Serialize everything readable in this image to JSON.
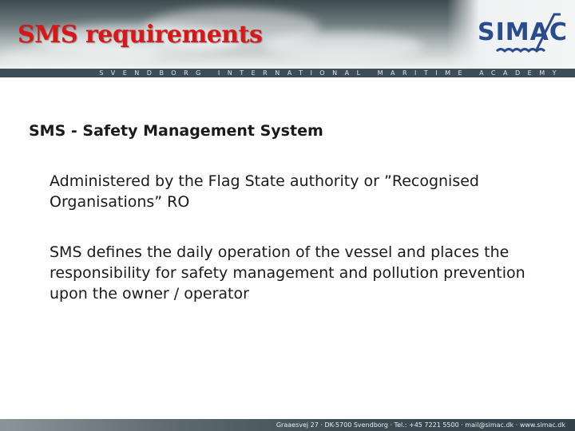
{
  "header": {
    "title": "SMS requirements",
    "logo_text": "SIMAC",
    "tagline": "SVENDBORG INTERNATIONAL MARITIME ACADEMY"
  },
  "content": {
    "heading": "SMS - Safety Management System",
    "paragraphs": [
      "Administered by the Flag State authority or ”Recognised Organisations” RO",
      "SMS defines the daily operation of the vessel and places the responsibility for safety management and pollution prevention upon the owner / operator"
    ]
  },
  "footer": {
    "contact": "Graaesvej 27 · DK-5700 Svendborg · Tel.: +45 7221 5500 · mail@simac.dk · www.simac.dk"
  },
  "colors": {
    "title": "#d81818",
    "logo": "#2a4b8e",
    "tagbar": "#3d4d57"
  }
}
